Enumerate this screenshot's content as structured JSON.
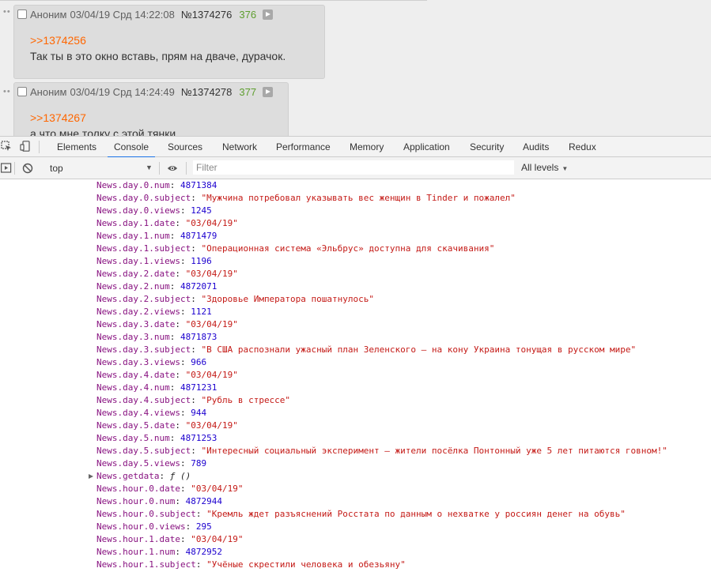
{
  "posts": [
    {
      "name": "Аноним",
      "date": "03/04/19 Срд 14:22:08",
      "num": "№1374276",
      "count": "376",
      "reply": ">>1374256",
      "text": "Так ты в это окно вставь, прям на дваче, дурачок."
    },
    {
      "name": "Аноним",
      "date": "03/04/19 Срд 14:24:49",
      "num": "№1374278",
      "count": "377",
      "reply": ">>1374267",
      "text": "а что мне толку с этой тянки"
    }
  ],
  "devtools": {
    "tabs": [
      "Elements",
      "Console",
      "Sources",
      "Network",
      "Performance",
      "Memory",
      "Application",
      "Security",
      "Audits",
      "Redux"
    ],
    "active_tab": "Console",
    "context": "top",
    "filter_placeholder": "Filter",
    "levels": "All levels",
    "icons": [
      "inspect-icon",
      "device-toolbar-icon",
      "sidebar-toggle-icon",
      "clear-console-icon",
      "eye-icon"
    ]
  },
  "console_lines": [
    {
      "key": "News.day.0.num",
      "value": "4871384",
      "type": "num"
    },
    {
      "key": "News.day.0.subject",
      "value": "\"Мужчина потребовал указывать вес женщин в Tinder и пожалел\"",
      "type": "str"
    },
    {
      "key": "News.day.0.views",
      "value": "1245",
      "type": "num"
    },
    {
      "key": "News.day.1.date",
      "value": "\"03/04/19\"",
      "type": "str"
    },
    {
      "key": "News.day.1.num",
      "value": "4871479",
      "type": "num"
    },
    {
      "key": "News.day.1.subject",
      "value": "\"Операционная система «Эльбрус» доступна для скачивания\"",
      "type": "str"
    },
    {
      "key": "News.day.1.views",
      "value": "1196",
      "type": "num"
    },
    {
      "key": "News.day.2.date",
      "value": "\"03/04/19\"",
      "type": "str"
    },
    {
      "key": "News.day.2.num",
      "value": "4872071",
      "type": "num"
    },
    {
      "key": "News.day.2.subject",
      "value": "\"Здоровье Императора пошатнулось\"",
      "type": "str"
    },
    {
      "key": "News.day.2.views",
      "value": "1121",
      "type": "num"
    },
    {
      "key": "News.day.3.date",
      "value": "\"03/04/19\"",
      "type": "str"
    },
    {
      "key": "News.day.3.num",
      "value": "4871873",
      "type": "num"
    },
    {
      "key": "News.day.3.subject",
      "value": "\"В США распознали ужасный план Зеленского — на кону Украина тонущая в русском мире\"",
      "type": "str"
    },
    {
      "key": "News.day.3.views",
      "value": "966",
      "type": "num"
    },
    {
      "key": "News.day.4.date",
      "value": "\"03/04/19\"",
      "type": "str"
    },
    {
      "key": "News.day.4.num",
      "value": "4871231",
      "type": "num"
    },
    {
      "key": "News.day.4.subject",
      "value": "\"Рубль в стрессе\"",
      "type": "str"
    },
    {
      "key": "News.day.4.views",
      "value": "944",
      "type": "num"
    },
    {
      "key": "News.day.5.date",
      "value": "\"03/04/19\"",
      "type": "str"
    },
    {
      "key": "News.day.5.num",
      "value": "4871253",
      "type": "num"
    },
    {
      "key": "News.day.5.subject",
      "value": "\"Интересный социальный эксперимент — жители посёлка Понтонный уже 5 лет питаются говном!\"",
      "type": "str"
    },
    {
      "key": "News.day.5.views",
      "value": "789",
      "type": "num"
    },
    {
      "key": "News.getdata",
      "value": "ƒ ()",
      "type": "fn"
    },
    {
      "key": "News.hour.0.date",
      "value": "\"03/04/19\"",
      "type": "str"
    },
    {
      "key": "News.hour.0.num",
      "value": "4872944",
      "type": "num"
    },
    {
      "key": "News.hour.0.subject",
      "value": "\"Кремль ждет разъяснений Росстата по данным о нехватке у россиян денег на обувь\"",
      "type": "str"
    },
    {
      "key": "News.hour.0.views",
      "value": "295",
      "type": "num"
    },
    {
      "key": "News.hour.1.date",
      "value": "\"03/04/19\"",
      "type": "str"
    },
    {
      "key": "News.hour.1.num",
      "value": "4872952",
      "type": "num"
    },
    {
      "key": "News.hour.1.subject",
      "value": "\"Учёные скрестили человека и обезьяну\"",
      "type": "str"
    }
  ],
  "colors": {
    "key": "#881280",
    "string": "#c41a16",
    "number": "#1c00cf",
    "reply_link": "#ff6600",
    "post_count": "#5e9e2f",
    "active_tab_underline": "#1a73e8"
  }
}
